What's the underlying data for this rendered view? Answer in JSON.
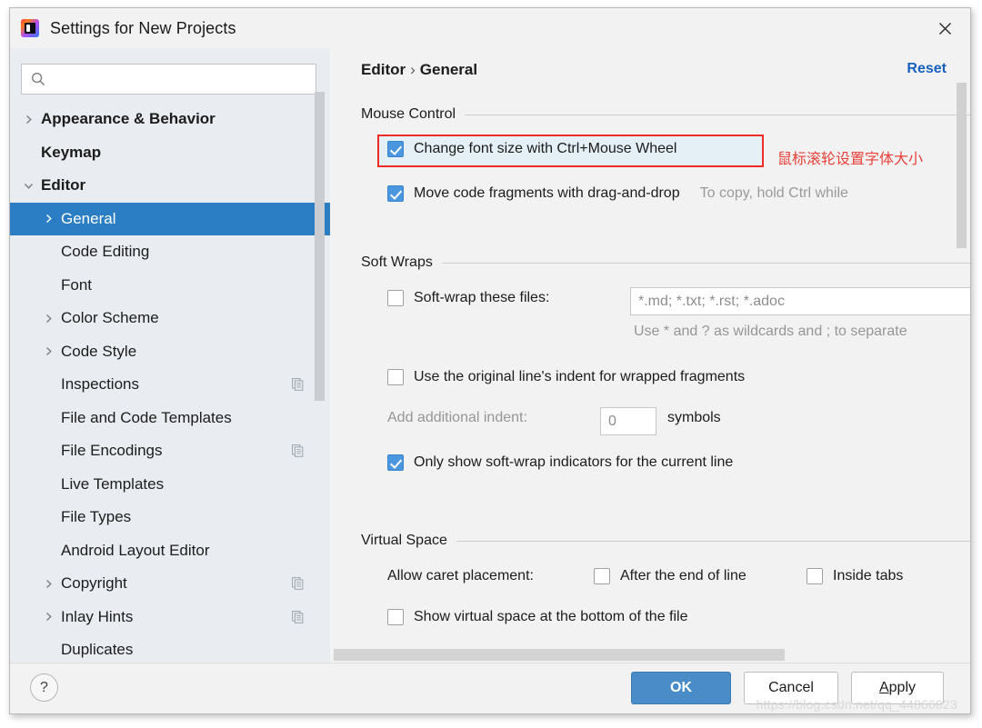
{
  "window": {
    "title": "Settings for New Projects",
    "app_icon": "intellij-idea-icon",
    "close_label": "×"
  },
  "sidebar": {
    "search": {
      "value": "",
      "placeholder": ""
    },
    "items": [
      {
        "label": "Appearance & Behavior",
        "arrow": "right",
        "bold": true,
        "indent": 14,
        "selected": false,
        "copy_icon": false
      },
      {
        "label": "Keymap",
        "arrow": "none",
        "bold": true,
        "indent": 14,
        "selected": false,
        "copy_icon": false
      },
      {
        "label": "Editor",
        "arrow": "down",
        "bold": true,
        "indent": 14,
        "selected": false,
        "copy_icon": false
      },
      {
        "label": "General",
        "arrow": "right",
        "bold": false,
        "indent": 36,
        "selected": true,
        "copy_icon": false
      },
      {
        "label": "Code Editing",
        "arrow": "none",
        "bold": false,
        "indent": 36,
        "selected": false,
        "copy_icon": false
      },
      {
        "label": "Font",
        "arrow": "none",
        "bold": false,
        "indent": 36,
        "selected": false,
        "copy_icon": false
      },
      {
        "label": "Color Scheme",
        "arrow": "right",
        "bold": false,
        "indent": 36,
        "selected": false,
        "copy_icon": false
      },
      {
        "label": "Code Style",
        "arrow": "right",
        "bold": false,
        "indent": 36,
        "selected": false,
        "copy_icon": false
      },
      {
        "label": "Inspections",
        "arrow": "none",
        "bold": false,
        "indent": 36,
        "selected": false,
        "copy_icon": true
      },
      {
        "label": "File and Code Templates",
        "arrow": "none",
        "bold": false,
        "indent": 36,
        "selected": false,
        "copy_icon": false
      },
      {
        "label": "File Encodings",
        "arrow": "none",
        "bold": false,
        "indent": 36,
        "selected": false,
        "copy_icon": true
      },
      {
        "label": "Live Templates",
        "arrow": "none",
        "bold": false,
        "indent": 36,
        "selected": false,
        "copy_icon": false
      },
      {
        "label": "File Types",
        "arrow": "none",
        "bold": false,
        "indent": 36,
        "selected": false,
        "copy_icon": false
      },
      {
        "label": "Android Layout Editor",
        "arrow": "none",
        "bold": false,
        "indent": 36,
        "selected": false,
        "copy_icon": false
      },
      {
        "label": "Copyright",
        "arrow": "right",
        "bold": false,
        "indent": 36,
        "selected": false,
        "copy_icon": true
      },
      {
        "label": "Inlay Hints",
        "arrow": "right",
        "bold": false,
        "indent": 36,
        "selected": false,
        "copy_icon": true
      },
      {
        "label": "Duplicates",
        "arrow": "none",
        "bold": false,
        "indent": 36,
        "selected": false,
        "copy_icon": false
      }
    ]
  },
  "main": {
    "breadcrumb": {
      "parent": "Editor",
      "separator": "›",
      "current": "General"
    },
    "reset_label": "Reset",
    "groups": {
      "mouse_control": {
        "title": "Mouse Control",
        "change_font_size": {
          "label": "Change font size with Ctrl+Mouse Wheel",
          "checked": true,
          "annotation": "鼠标滚轮设置字体大小"
        },
        "move_code_fragments": {
          "label": "Move code fragments with drag-and-drop",
          "checked": true,
          "hint": "To copy, hold Ctrl while"
        }
      },
      "soft_wraps": {
        "title": "Soft Wraps",
        "soft_wrap_files": {
          "label": "Soft-wrap these files:",
          "checked": false,
          "value": "*.md; *.txt; *.rst; *.adoc",
          "help": "Use * and ? as wildcards and ; to separate"
        },
        "original_indent": {
          "label": "Use the original line's indent for wrapped fragments",
          "checked": false
        },
        "additional_indent": {
          "label": "Add additional indent:",
          "value": "0",
          "unit": "symbols"
        },
        "only_show_indicators": {
          "label": "Only show soft-wrap indicators for the current line",
          "checked": true
        }
      },
      "virtual_space": {
        "title": "Virtual Space",
        "allow_caret_label": "Allow caret placement:",
        "after_end_of_line": {
          "label": "After the end of line",
          "checked": false
        },
        "inside_tabs": {
          "label": "Inside tabs",
          "checked": false
        },
        "show_virtual_space": {
          "label": "Show virtual space at the bottom of the file",
          "checked": false
        }
      }
    }
  },
  "footer": {
    "help_label": "?",
    "ok_label": "OK",
    "cancel_label": "Cancel",
    "apply_mnemonic": "A",
    "apply_rest": "pply"
  },
  "watermark": "https://blog.csdn.net/qq_44866823",
  "colors": {
    "accent": "#2b7ec4",
    "primary_button": "#4a8cc7",
    "link": "#1661be",
    "annotation_red": "#e8403a",
    "highlight_border": "#ee2b24"
  }
}
